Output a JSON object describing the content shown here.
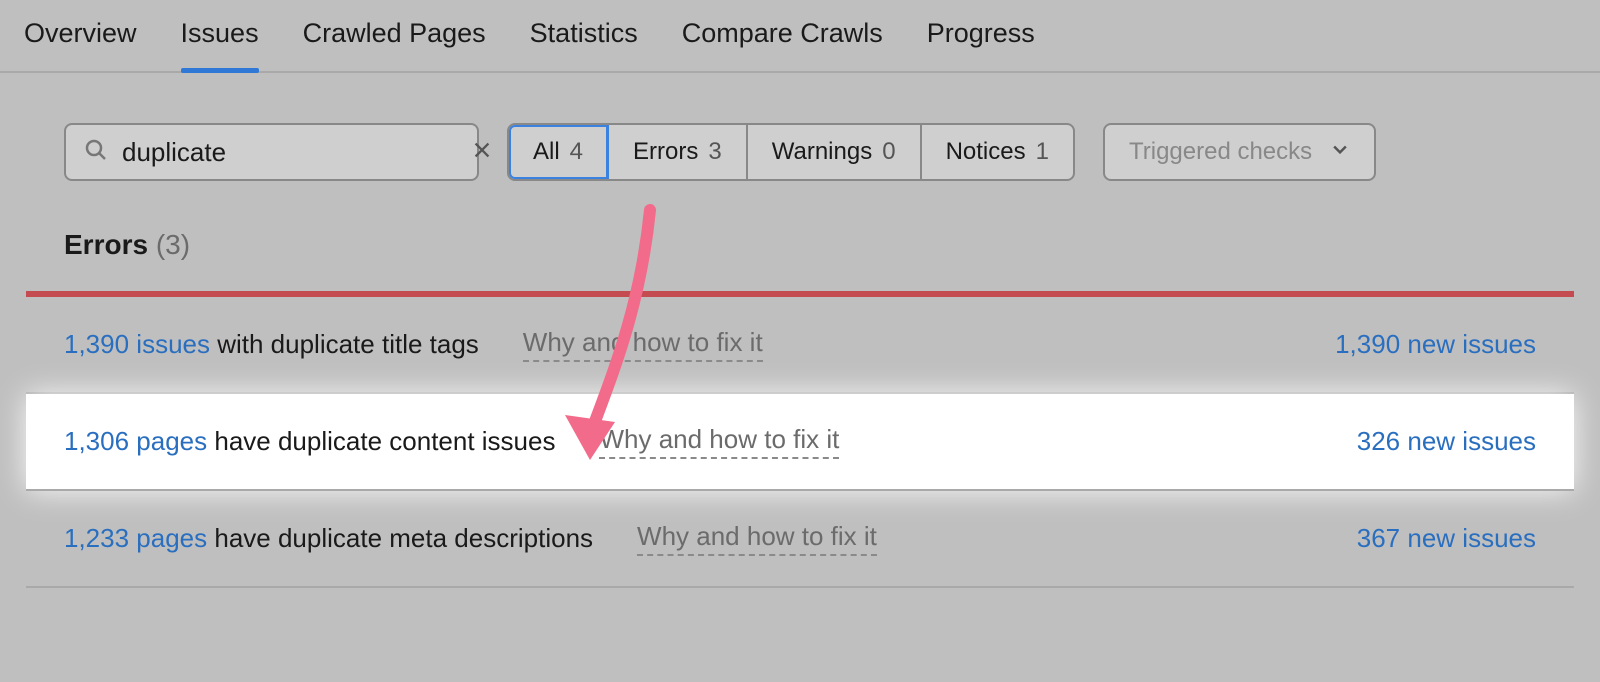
{
  "tabs": {
    "items": [
      {
        "label": "Overview"
      },
      {
        "label": "Issues"
      },
      {
        "label": "Crawled Pages"
      },
      {
        "label": "Statistics"
      },
      {
        "label": "Compare Crawls"
      },
      {
        "label": "Progress"
      }
    ],
    "active_index": 1
  },
  "search": {
    "value": "duplicate"
  },
  "filters": {
    "items": [
      {
        "label": "All",
        "count": "4"
      },
      {
        "label": "Errors",
        "count": "3"
      },
      {
        "label": "Warnings",
        "count": "0"
      },
      {
        "label": "Notices",
        "count": "1"
      }
    ],
    "active_index": 0
  },
  "dropdown": {
    "selected": "Triggered checks"
  },
  "section": {
    "title": "Errors",
    "count": "(3)"
  },
  "issues": [
    {
      "count_link": "1,390 issues",
      "rest": " with duplicate title tags",
      "fix": "Why and how to fix it",
      "new": "1,390 new issues"
    },
    {
      "count_link": "1,306 pages",
      "rest": " have duplicate content issues",
      "fix": "Why and how to fix it",
      "new": "326 new issues"
    },
    {
      "count_link": "1,233 pages",
      "rest": " have duplicate meta descriptions",
      "fix": "Why and how to fix it",
      "new": "367 new issues"
    }
  ]
}
